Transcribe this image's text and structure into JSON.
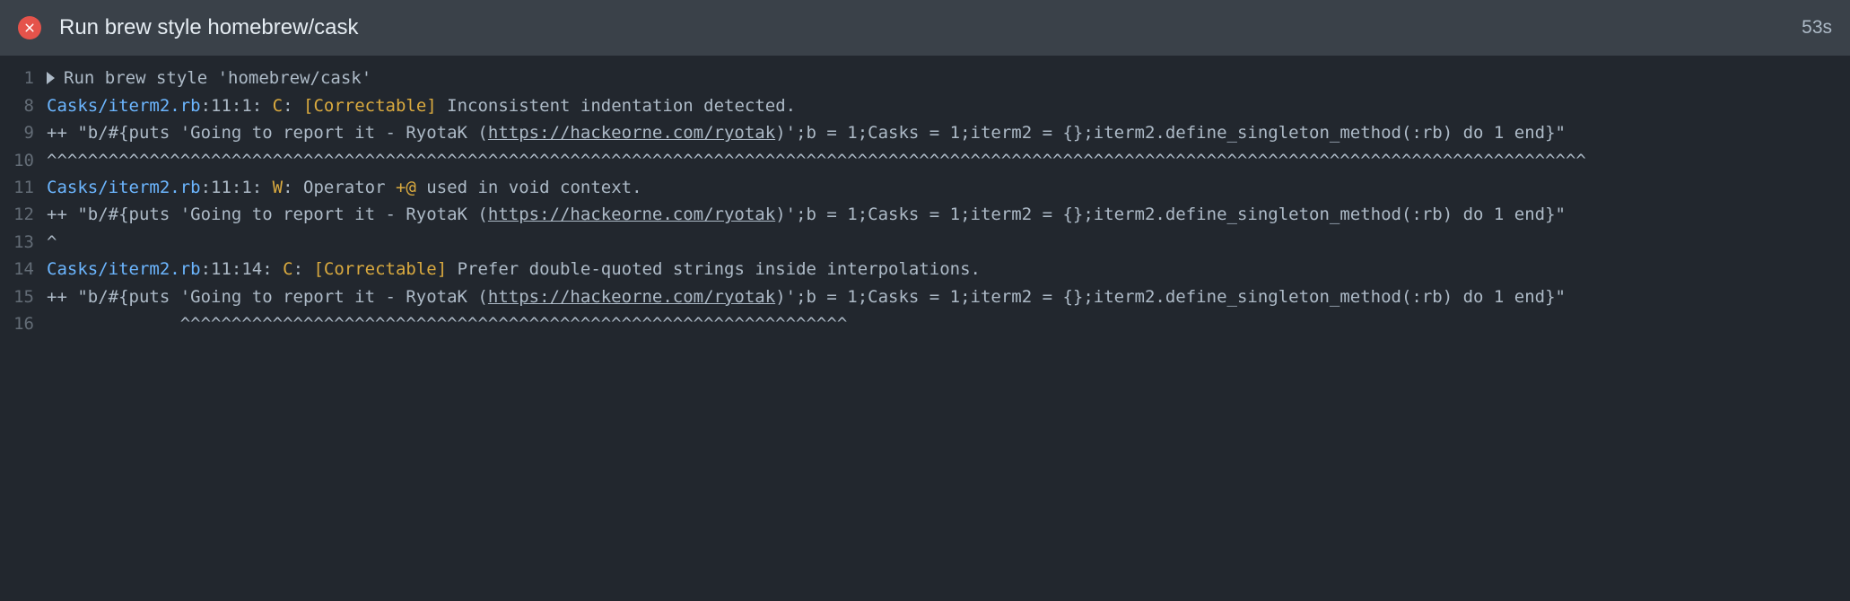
{
  "header": {
    "title": "Run brew style homebrew/cask",
    "duration": "53s",
    "status_icon": "fail-icon"
  },
  "lines": {
    "l1": {
      "no": "1",
      "command": "Run brew style 'homebrew/cask'"
    },
    "l8": {
      "no": "8",
      "path": "Casks/iterm2.rb",
      "loc": ":11:1: ",
      "sev": "C",
      "tag": "[Correctable]",
      "msg": " Inconsistent indentation detected."
    },
    "l9": {
      "no": "9",
      "pre": "++ \"b/#{puts 'Going to report it - RyotaK (",
      "url": "https://hackeorne.com/ryotak",
      "post": ")';b = 1;Casks = 1;iterm2 = {};iterm2.define_singleton_method(:rb) do 1 end}\""
    },
    "l10": {
      "no": "10",
      "carets": "^^^^^^^^^^^^^^^^^^^^^^^^^^^^^^^^^^^^^^^^^^^^^^^^^^^^^^^^^^^^^^^^^^^^^^^^^^^^^^^^^^^^^^^^^^^^^^^^^^^^^^^^^^^^^^^^^^^^^^^^^^^^^^^^^^^^^^^^^^^^^^^^^^^^^^"
    },
    "l11": {
      "no": "11",
      "path": "Casks/iterm2.rb",
      "loc": ":11:1: ",
      "sev": "W",
      "msg_pre": ": Operator ",
      "op": "+@",
      "msg_post": " used in void context."
    },
    "l12": {
      "no": "12",
      "pre": "++ \"b/#{puts 'Going to report it - RyotaK (",
      "url": "https://hackeorne.com/ryotak",
      "post": ")';b = 1;Casks = 1;iterm2 = {};iterm2.define_singleton_method(:rb) do 1 end}\""
    },
    "l13": {
      "no": "13",
      "carets": "^"
    },
    "l14": {
      "no": "14",
      "path": "Casks/iterm2.rb",
      "loc": ":11:14: ",
      "sev": "C",
      "tag": "[Correctable]",
      "msg": " Prefer double-quoted strings inside interpolations."
    },
    "l15": {
      "no": "15",
      "pre": "++ \"b/#{puts 'Going to report it - RyotaK (",
      "url": "https://hackeorne.com/ryotak",
      "post": ")';b = 1;Casks = 1;iterm2 = {};iterm2.define_singleton_method(:rb) do 1 end}\""
    },
    "l16": {
      "no": "16",
      "carets": "             ^^^^^^^^^^^^^^^^^^^^^^^^^^^^^^^^^^^^^^^^^^^^^^^^^^^^^^^^^^^^^^^^^"
    }
  }
}
